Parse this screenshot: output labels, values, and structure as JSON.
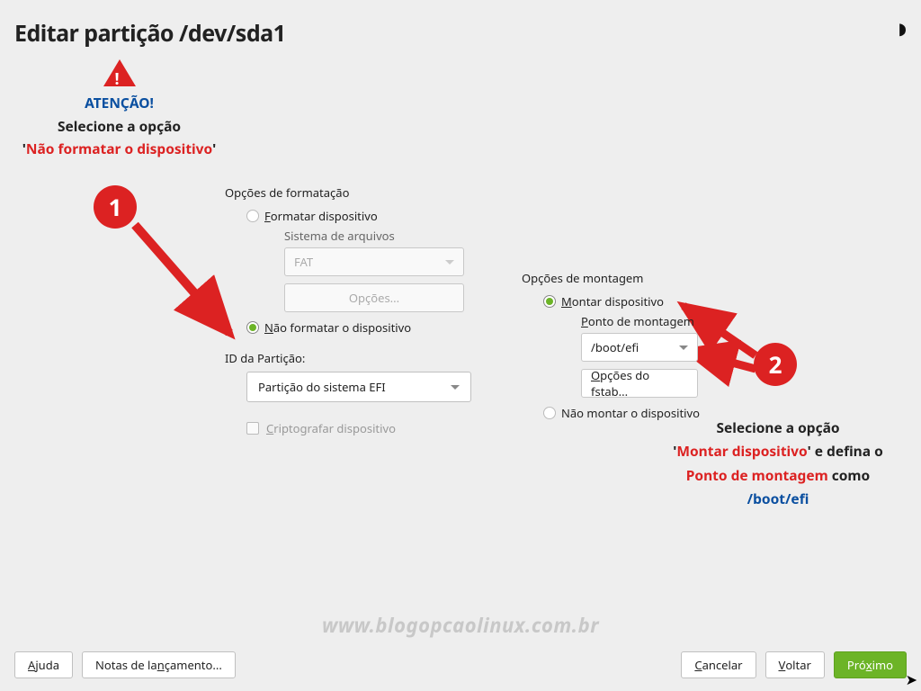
{
  "header": {
    "title": "Editar partição /dev/sda1"
  },
  "annot1": {
    "attention": "ATENÇÃO!",
    "line1": "Selecione a opção",
    "line2": "Não formatar o dispositivo"
  },
  "annot2": {
    "line1": "Selecione a opção",
    "mount": "Montar dispositivo",
    "line2_tail": " e defina o ",
    "pdm": "Ponto de montagem",
    "como": " como",
    "path": "/boot/efi"
  },
  "badges": {
    "one": "1",
    "two": "2"
  },
  "format": {
    "section": "Opções de formatação",
    "format_first": "F",
    "format_rest": "ormatar dispositivo",
    "fs_label": "Sistema de arquivos",
    "fs_value": "FAT",
    "options_btn": "Opções...",
    "noformat_first": "N",
    "noformat_rest": "ão formatar o dispositivo"
  },
  "partition_id": {
    "label": "ID da Partição:",
    "value": "Partição do sistema EFI"
  },
  "crypto": {
    "first": "C",
    "rest": "riptografar dispositivo"
  },
  "mount": {
    "section": "Opções de montagem",
    "mount_first": "M",
    "mount_rest": "ontar dispositivo",
    "point_first": "P",
    "point_rest": "onto de montagem",
    "point_value": "/boot/efi",
    "fstab_first": "O",
    "fstab_rest": "pções do fstab...",
    "nomount": "Não montar o dispositivo"
  },
  "watermark": "www.blogopcaolinux.com.br",
  "footer": {
    "help_first": "A",
    "help_rest": "juda",
    "notes_pre": "Notas de la",
    "notes_under": "n",
    "notes_post": "çamento...",
    "cancel_first": "C",
    "cancel_rest": "ancelar",
    "back_first": "V",
    "back_rest": "oltar",
    "next_pre": "Pró",
    "next_under": "x",
    "next_post": "imo"
  }
}
